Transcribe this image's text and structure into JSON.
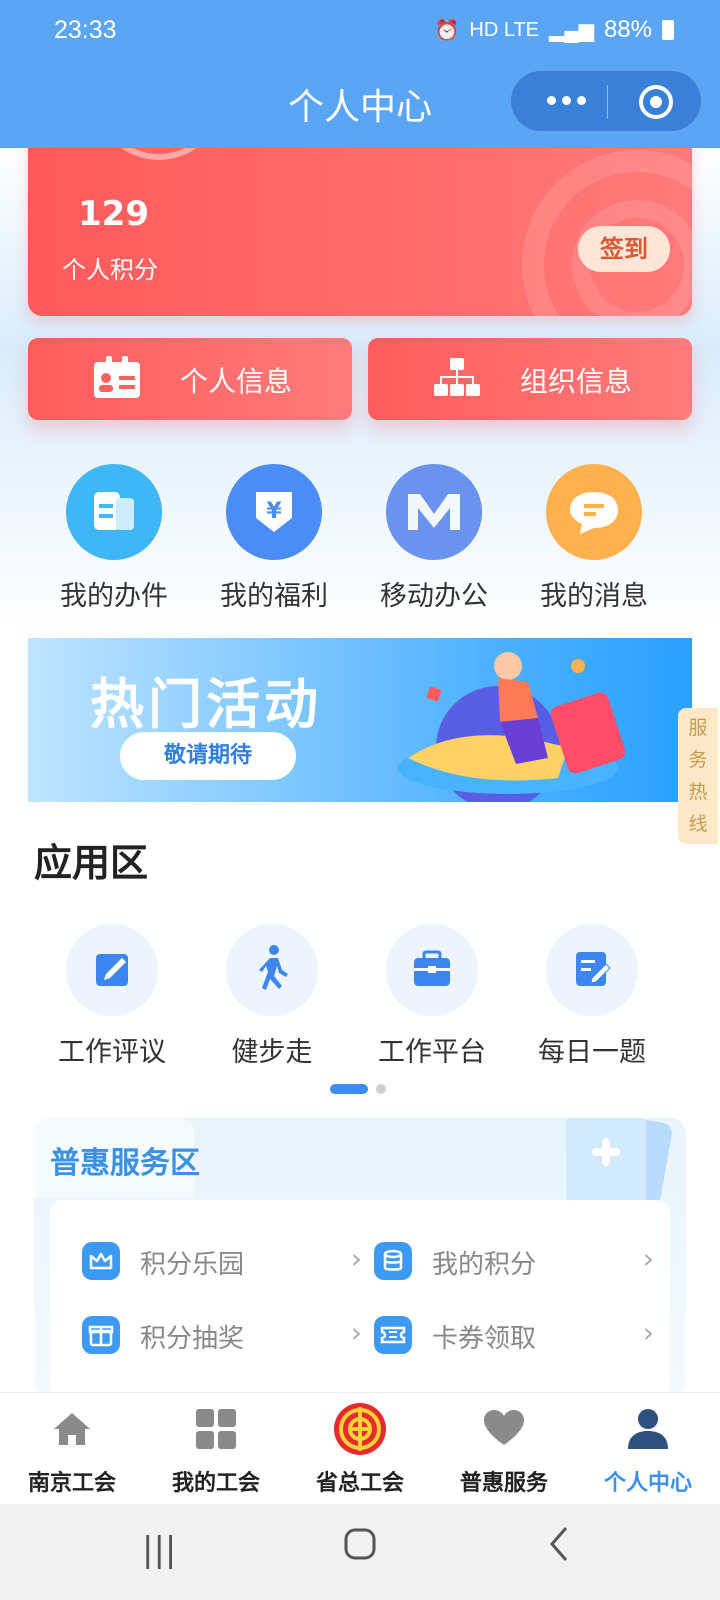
{
  "status": {
    "time": "23:33",
    "signal": "HD LTE",
    "battery": "88%"
  },
  "header": {
    "title": "个人中心"
  },
  "points": {
    "value": "129",
    "label": "个人积分",
    "checkin_label": "签到"
  },
  "info_buttons": {
    "personal": "个人信息",
    "org": "组织信息"
  },
  "quick_actions": [
    {
      "label": "我的办件",
      "icon": "document-icon",
      "color": "#3fb6f5"
    },
    {
      "label": "我的福利",
      "icon": "yuan-shield-icon",
      "color": "#4b8df5"
    },
    {
      "label": "移动办公",
      "icon": "m-logo-icon",
      "color": "#6a93f0"
    },
    {
      "label": "我的消息",
      "icon": "chat-bubble-icon",
      "color": "#ffb14e"
    }
  ],
  "banner": {
    "title": "热门活动",
    "button": "敬请期待"
  },
  "hotline": {
    "label": "服务热线"
  },
  "app_zone": {
    "title": "应用区",
    "apps": [
      {
        "label": "工作评议",
        "icon": "edit-icon"
      },
      {
        "label": "健步走",
        "icon": "walking-icon"
      },
      {
        "label": "工作平台",
        "icon": "briefcase-icon"
      },
      {
        "label": "每日一题",
        "icon": "quiz-icon"
      }
    ],
    "page_indicator": {
      "current": 1,
      "total": 2
    }
  },
  "benefits": {
    "title": "普惠服务区",
    "items": [
      {
        "label": "积分乐园",
        "icon": "crown-icon"
      },
      {
        "label": "我的积分",
        "icon": "database-icon"
      },
      {
        "label": "积分抽奖",
        "icon": "gift-icon"
      },
      {
        "label": "卡券领取",
        "icon": "ticket-icon"
      }
    ]
  },
  "tabbar": [
    {
      "label": "南京工会",
      "icon": "home-icon"
    },
    {
      "label": "我的工会",
      "icon": "grid-icon"
    },
    {
      "label": "省总工会",
      "icon": "union-emblem-icon"
    },
    {
      "label": "普惠服务",
      "icon": "heart-icon"
    },
    {
      "label": "个人中心",
      "icon": "person-icon",
      "active": true
    }
  ],
  "colors": {
    "accent": "#3a8ff0",
    "header": "#5ba5f5",
    "card_red": "#ff5a5a"
  }
}
